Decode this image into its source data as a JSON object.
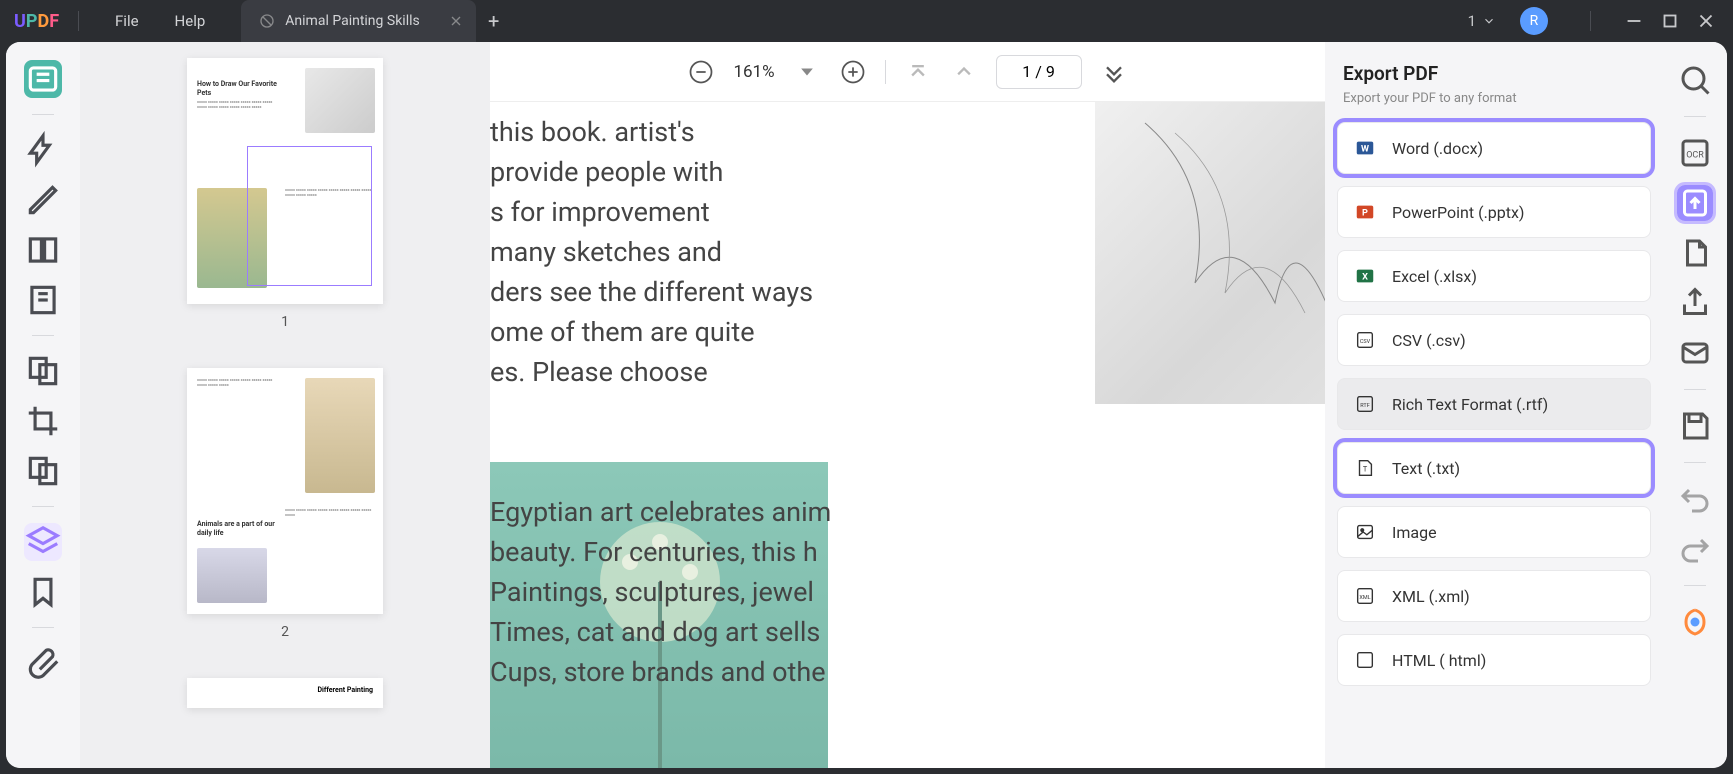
{
  "titlebar": {
    "menu": {
      "file": "File",
      "help": "Help"
    },
    "tab": {
      "title": "Animal Painting Skills"
    },
    "badge_num": "1",
    "avatar_letter": "R"
  },
  "toolbar": {
    "zoom": "161%",
    "page": "1 / 9"
  },
  "document": {
    "line1": "this book. artist's",
    "line2": "provide people with",
    "line3": "s for improvement",
    "line4": "many sketches and",
    "line5": "ders see the different ways",
    "line6": "ome of them are quite",
    "line7": "es. Please choose",
    "para2_line1": "Egyptian art celebrates anim",
    "para2_line2": "beauty. For centuries, this h",
    "para2_line3": "Paintings, sculptures, jewel",
    "para2_line4": "Times, cat and dog art sells",
    "para2_line5": "Cups, store brands and othe"
  },
  "thumbs": {
    "p1_heading": "How to Draw Our Favorite Pets",
    "p1_num": "1",
    "p2_heading": "Animals are a part of our daily life",
    "p2_num": "2",
    "p3_heading": "Different Painting"
  },
  "export": {
    "title": "Export PDF",
    "subtitle": "Export your PDF to any format",
    "options": {
      "word": "Word (.docx)",
      "ppt": "PowerPoint (.pptx)",
      "excel": "Excel (.xlsx)",
      "csv": "CSV (.csv)",
      "rtf": "Rich Text Format (.rtf)",
      "txt": "Text (.txt)",
      "image": "Image",
      "xml": "XML (.xml)",
      "html": "HTML ( html)"
    }
  }
}
